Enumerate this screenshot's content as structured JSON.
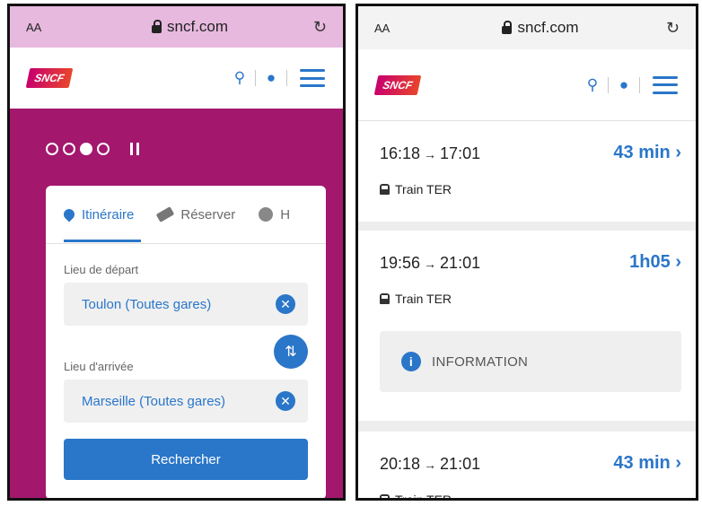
{
  "browser": {
    "text_size_label": "AA",
    "url": "sncf.com",
    "reload_glyph": "↻"
  },
  "site": {
    "logo_text": "SNCF",
    "search_glyph": "⚲",
    "account_glyph": "●"
  },
  "left": {
    "carousel": {
      "total": 4,
      "active_index": 2
    },
    "tabs": [
      {
        "label": "Itinéraire",
        "icon": "location-pin-icon",
        "active": true
      },
      {
        "label": "Réserver",
        "icon": "ticket-icon",
        "active": false
      },
      {
        "label": "H",
        "icon": "clock-icon",
        "active": false
      }
    ],
    "departure": {
      "label": "Lieu de départ",
      "value": "Toulon (Toutes gares)"
    },
    "arrival": {
      "label": "Lieu d'arrivée",
      "value": "Marseille (Toutes gares)"
    },
    "clear_glyph": "✕",
    "swap_glyph": "⇅",
    "search_button": "Rechercher"
  },
  "right": {
    "journeys": [
      {
        "departure": "16:18",
        "arrival": "17:01",
        "duration": "43 min",
        "type": "Train TER"
      },
      {
        "departure": "19:56",
        "arrival": "21:01",
        "duration": "1h05",
        "type": "Train TER"
      },
      {
        "departure": "20:18",
        "arrival": "21:01",
        "duration": "43 min",
        "type": "Train TER"
      }
    ],
    "info_label": "INFORMATION",
    "arrow_glyph": "→",
    "chevron_glyph": "›"
  },
  "colors": {
    "brand_magenta": "#a3176d",
    "accent_blue": "#2a76c9"
  }
}
